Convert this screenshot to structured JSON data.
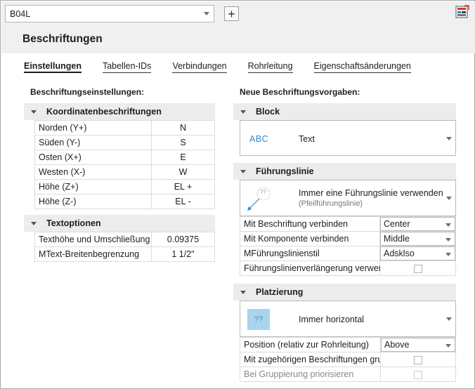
{
  "header": {
    "style_select_value": "B04L",
    "add_label": "+",
    "title": "Beschriftungen"
  },
  "tabs": [
    {
      "label": "Einstellungen",
      "active": true
    },
    {
      "label": "Tabellen-IDs",
      "active": false
    },
    {
      "label": "Verbindungen",
      "active": false
    },
    {
      "label": "Rohrleitung",
      "active": false
    },
    {
      "label": "Eigenschaftsänderungen",
      "active": false
    }
  ],
  "left": {
    "heading": "Beschriftungseinstellungen:",
    "coords": {
      "title": "Koordinatenbeschriftungen",
      "rows": [
        {
          "label": "Norden (Y+)",
          "value": "N"
        },
        {
          "label": "Süden (Y-)",
          "value": "S"
        },
        {
          "label": "Osten (X+)",
          "value": "E"
        },
        {
          "label": "Westen (X-)",
          "value": "W"
        },
        {
          "label": "Höhe (Z+)",
          "value": "EL +"
        },
        {
          "label": "Höhe (Z-)",
          "value": "EL -"
        }
      ]
    },
    "text": {
      "title": "Textoptionen",
      "rows": [
        {
          "label": "Texthöhe und Umschließung",
          "value": "0.09375"
        },
        {
          "label": "MText-Breitenbegrenzung",
          "value": "1 1/2\""
        }
      ]
    }
  },
  "right": {
    "heading": "Neue Beschriftungsvorgaben:",
    "block": {
      "title": "Block",
      "preview_text": "ABC",
      "value": "Text"
    },
    "leader": {
      "title": "Führungslinie",
      "icon_text": "??",
      "value": "Immer eine Führungslinie verwenden",
      "subvalue": "(Pfeilführungslinie)",
      "rows": [
        {
          "label": "Mit Beschriftung verbinden",
          "value": "Center"
        },
        {
          "label": "Mit Komponente verbinden",
          "value": "Middle"
        },
        {
          "label": "MFührungslinienstil",
          "value": "Adsklso"
        }
      ],
      "check_label": "Führungslinienverlängerung verwenden"
    },
    "placement": {
      "title": "Platzierung",
      "icon_text": "??",
      "value": "Immer horizontal",
      "rows": [
        {
          "label": "Position (relativ zur Rohrleitung)",
          "value": "Above"
        }
      ],
      "check1_label": "Mit zugehörigen Beschriftungen gruppieren",
      "check2_label": "Bei Gruppierung priorisieren"
    }
  },
  "colors": {
    "accent": "#2f86c9",
    "header_bg": "#f0f0f0",
    "group_bg": "#ececec",
    "placement_icon_bg": "#a8d4ee"
  }
}
